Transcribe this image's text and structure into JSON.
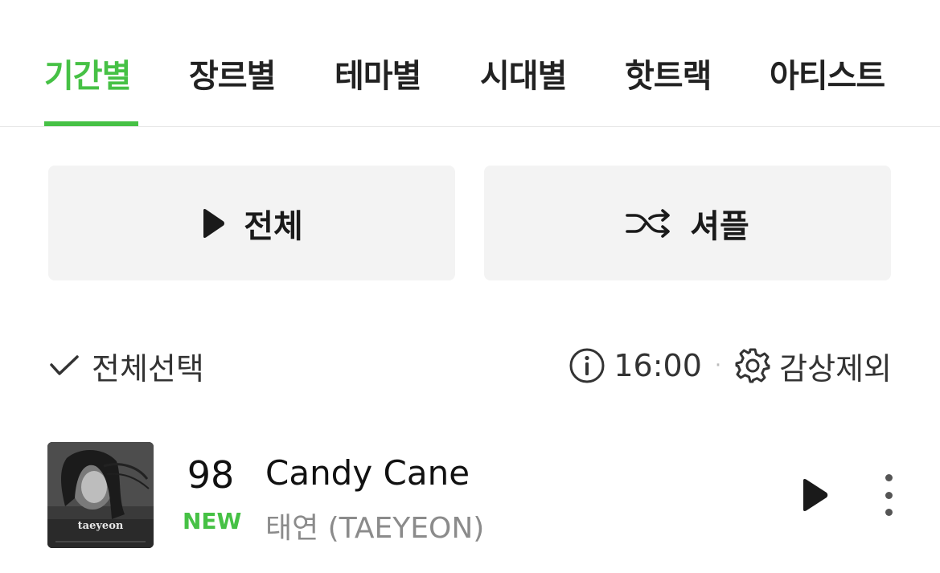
{
  "tabs": [
    {
      "label": "기간별",
      "active": true
    },
    {
      "label": "장르별",
      "active": false
    },
    {
      "label": "테마별",
      "active": false
    },
    {
      "label": "시대별",
      "active": false
    },
    {
      "label": "핫트랙",
      "active": false
    },
    {
      "label": "아티스트",
      "active": false
    }
  ],
  "actions": {
    "play_all": {
      "label": "전체",
      "icon": "play-icon"
    },
    "shuffle": {
      "label": "셔플",
      "icon": "shuffle-icon"
    }
  },
  "controls": {
    "select_all_label": "전체선택",
    "select_icon": "check-icon",
    "info_icon": "info-icon",
    "time": "16:00",
    "separator": "·",
    "exclude_icon": "gear-icon",
    "exclude_label": "감상제외"
  },
  "track": {
    "rank": "98",
    "badge": "NEW",
    "title": "Candy Cane",
    "artist": "태연 (TAEYEON)",
    "cover_text": "taeyeon",
    "play_icon": "play-icon",
    "more_icon": "more-vertical-icon"
  },
  "colors": {
    "accent": "#46c145",
    "button_bg": "#f3f3f3",
    "divider": "#e8e8e8",
    "secondary_text": "#8b8b8b"
  }
}
